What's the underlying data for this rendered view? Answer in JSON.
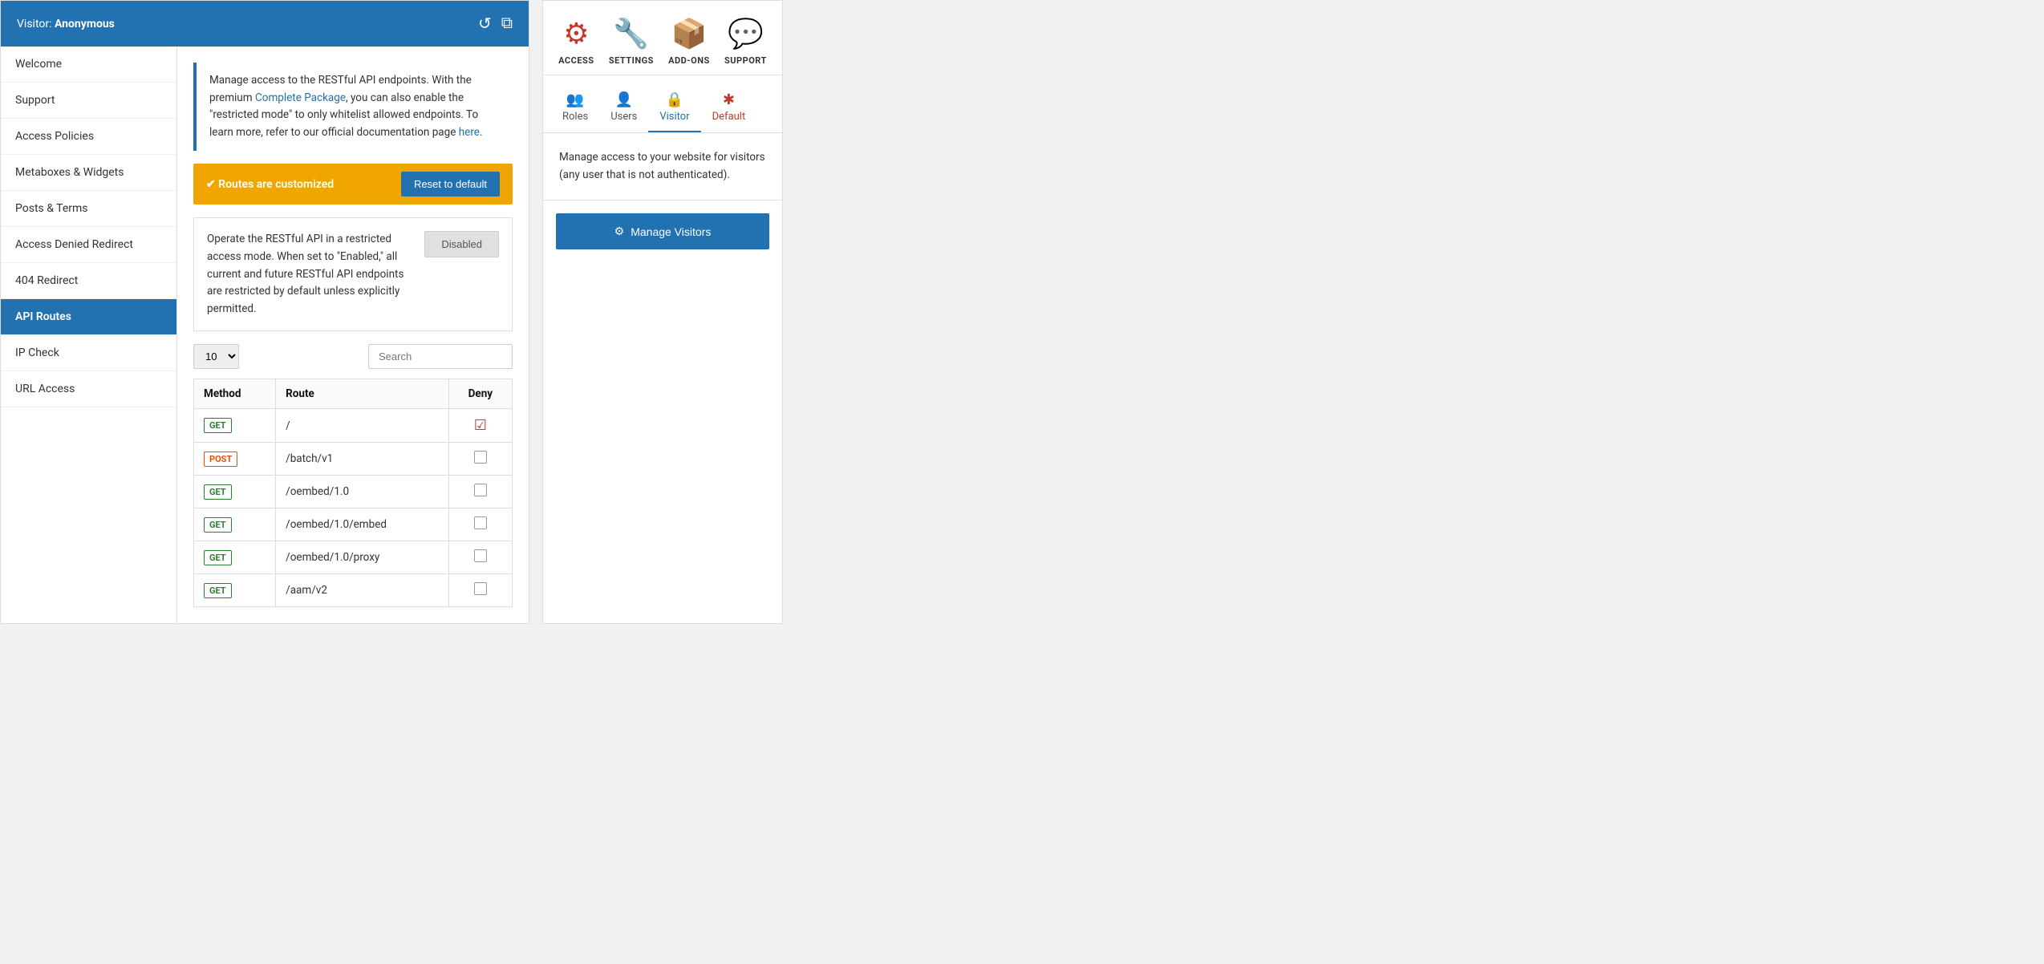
{
  "header": {
    "title_prefix": "Visitor: ",
    "title_bold": "Anonymous",
    "icon_reset": "↺",
    "icon_code": "⊞"
  },
  "sidebar": {
    "items": [
      {
        "id": "welcome",
        "label": "Welcome",
        "active": false
      },
      {
        "id": "support",
        "label": "Support",
        "active": false
      },
      {
        "id": "access-policies",
        "label": "Access Policies",
        "active": false
      },
      {
        "id": "metaboxes",
        "label": "Metaboxes & Widgets",
        "active": false
      },
      {
        "id": "posts-terms",
        "label": "Posts & Terms",
        "active": false
      },
      {
        "id": "access-denied",
        "label": "Access Denied Redirect",
        "active": false
      },
      {
        "id": "404-redirect",
        "label": "404 Redirect",
        "active": false
      },
      {
        "id": "api-routes",
        "label": "API Routes",
        "active": true
      },
      {
        "id": "ip-check",
        "label": "IP Check",
        "active": false
      },
      {
        "id": "url-access",
        "label": "URL Access",
        "active": false
      }
    ]
  },
  "main": {
    "info_text_1": "Manage access to the RESTful API endpoints. With the premium ",
    "info_link_1": "Complete Package",
    "info_text_2": ", you can also enable the \"restricted mode\" to only whitelist allowed endpoints. To learn more, refer to our official documentation page ",
    "info_link_2": "here",
    "info_text_3": ".",
    "notice_text": "✔ Routes are customized",
    "reset_btn": "Reset to default",
    "restricted_desc": "Operate the RESTful API in a restricted access mode. When set to \"Enabled,\" all current and future RESTful API endpoints are restricted by default unless explicitly permitted.",
    "disabled_label": "Disabled",
    "per_page_default": "10",
    "search_placeholder": "Search",
    "table_headers": {
      "method": "Method",
      "route": "Route",
      "deny": "Deny"
    },
    "routes": [
      {
        "method": "GET",
        "method_type": "get",
        "route": "/",
        "denied": true
      },
      {
        "method": "POST",
        "method_type": "post",
        "route": "/batch/v1",
        "denied": false
      },
      {
        "method": "GET",
        "method_type": "get",
        "route": "/oembed/1.0",
        "denied": false
      },
      {
        "method": "GET",
        "method_type": "get",
        "route": "/oembed/1.0/embed",
        "denied": false
      },
      {
        "method": "GET",
        "method_type": "get",
        "route": "/oembed/1.0/proxy",
        "denied": false
      },
      {
        "method": "GET",
        "method_type": "get",
        "route": "/aam/v2",
        "denied": false
      }
    ]
  },
  "right_panel": {
    "icons": [
      {
        "id": "access",
        "label": "ACCESS",
        "type": "access"
      },
      {
        "id": "settings",
        "label": "SETTINGS",
        "type": "settings"
      },
      {
        "id": "addons",
        "label": "ADD-ONS",
        "type": "addons"
      },
      {
        "id": "support",
        "label": "SUPPORT",
        "type": "support"
      }
    ],
    "tabs": [
      {
        "id": "roles",
        "label": "Roles",
        "icon": "👥"
      },
      {
        "id": "users",
        "label": "Users",
        "icon": "👤"
      },
      {
        "id": "visitor",
        "label": "Visitor",
        "icon": "🔒",
        "active": true
      },
      {
        "id": "default",
        "label": "Default",
        "icon": "✱",
        "red": true
      }
    ],
    "visitor_desc": "Manage access to your website for visitors (any user that is not authenticated).",
    "manage_btn": "Manage Visitors"
  }
}
